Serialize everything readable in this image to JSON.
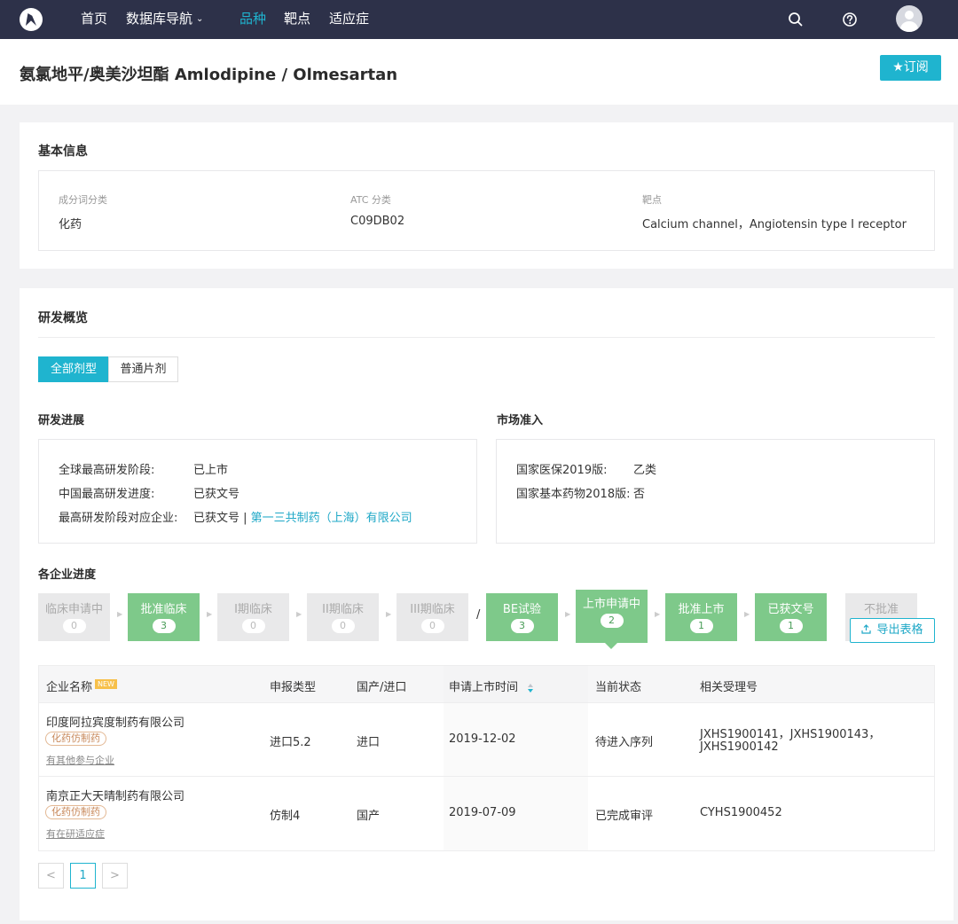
{
  "nav": {
    "items": [
      "首页",
      "数据库导航",
      "品种",
      "靶点",
      "适应症"
    ],
    "active_index": 2
  },
  "page": {
    "title": "氨氯地平/奥美沙坦酯 Amlodipine / Olmesartan",
    "subscribe_label": "★订阅"
  },
  "basic_info": {
    "title": "基本信息",
    "fields": [
      {
        "label": "成分词分类",
        "value": "化药"
      },
      {
        "label": "ATC 分类",
        "value": "C09DB02"
      },
      {
        "label": "靶点",
        "value": "Calcium channel，Angiotensin type I receptor"
      }
    ]
  },
  "rd_overview": {
    "title": "研发概览",
    "tabs": [
      "全部剂型",
      "普通片剂"
    ],
    "active_tab": 0,
    "progress": {
      "title": "研发进展",
      "rows": [
        {
          "label": "全球最高研发阶段:",
          "value": "已上市"
        },
        {
          "label": "中国最高研发进度:",
          "value": "已获文号"
        },
        {
          "label": "最高研发阶段对应企业:",
          "value": "已获文号 | ",
          "link": "第一三共制药（上海）有限公司"
        }
      ]
    },
    "market": {
      "title": "市场准入",
      "rows": [
        {
          "label": "国家医保2019版:",
          "value": "乙类",
          "is_link": true
        },
        {
          "label": "国家基本药物2018版:",
          "value": "否",
          "is_link": false
        }
      ]
    }
  },
  "company_progress": {
    "title": "各企业进度",
    "stages": [
      {
        "name": "临床申请中",
        "count": "0",
        "active": false
      },
      {
        "name": "批准临床",
        "count": "3",
        "active": true
      },
      {
        "name": "I期临床",
        "count": "0",
        "active": false
      },
      {
        "name": "II期临床",
        "count": "0",
        "active": false
      },
      {
        "name": "III期临床",
        "count": "0",
        "active": false
      },
      {
        "name": "BE试验",
        "count": "3",
        "active": true
      },
      {
        "name": "上市申请中",
        "count": "2",
        "active": true
      },
      {
        "name": "批准上市",
        "count": "1",
        "active": true
      },
      {
        "name": "已获文号",
        "count": "1",
        "active": true
      },
      {
        "name": "不批准",
        "count": "",
        "active": false
      }
    ],
    "slash": "/",
    "export_label": "导出表格"
  },
  "table": {
    "headers": [
      "企业名称",
      "申报类型",
      "国产/进口",
      "申请上市时间",
      "当前状态",
      "相关受理号"
    ],
    "new_badge": "NEW",
    "rows": [
      {
        "company": "印度阿拉宾度制药有限公司",
        "badge": "化药仿制药",
        "sub": "有其他参与企业",
        "type": "进口5.2",
        "origin": "进口",
        "date": "2019-12-02",
        "status": "待进入序列",
        "numbers_line1": "JXHS1900141，JXHS1900143，",
        "numbers_line2": "JXHS1900142"
      },
      {
        "company": "南京正大天晴制药有限公司",
        "badge": "化药仿制药",
        "sub": "有在研适应症",
        "type": "仿制4",
        "origin": "国产",
        "date": "2019-07-09",
        "status": "已完成审评",
        "numbers_line1": "CYHS1900452",
        "numbers_line2": ""
      }
    ]
  },
  "pagination": {
    "prev": "<",
    "current": "1",
    "next": ">"
  },
  "colors": {
    "nav_bg": "#2d3149",
    "accent": "#1fb4cf",
    "stage_active": "#7ec98a"
  }
}
